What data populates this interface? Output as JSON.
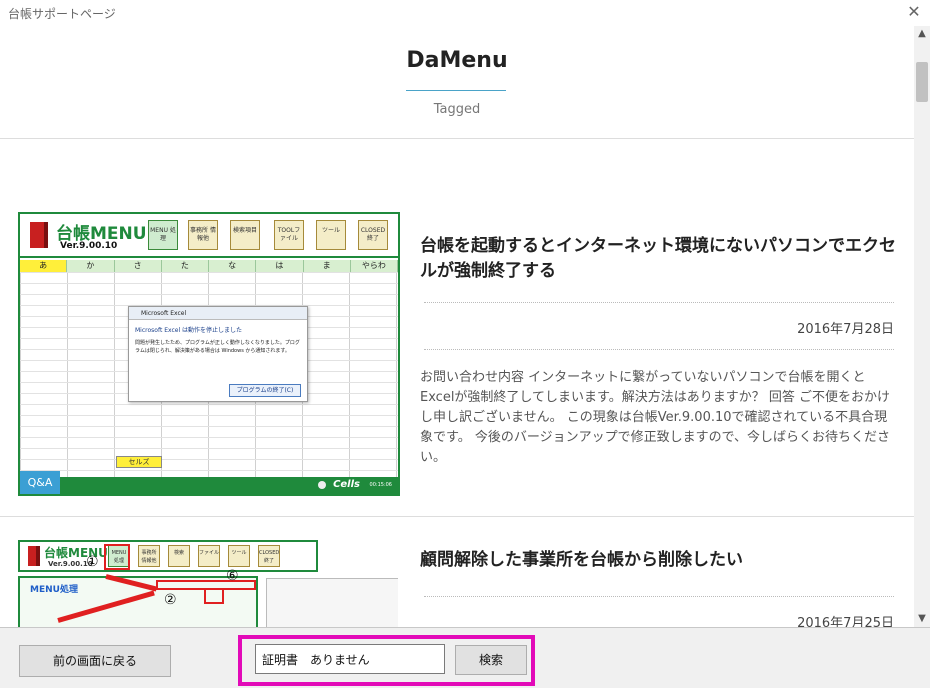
{
  "window": {
    "title": "台帳サポートページ",
    "close_glyph": "✕"
  },
  "header": {
    "title": "DaMenu",
    "subtitle": "Tagged"
  },
  "posts": [
    {
      "title": "台帳を起動するとインターネット環境にないパソコンでエクセルが強制終了する",
      "date": "2016年7月28日",
      "excerpt": "お問い合わせ内容 インターネットに繋がっていないパソコンで台帳を開くとExcelが強制終了してしまいます。解決方法はありますか？ 回答 ご不便をおかけし申し訳ございません。 この現象は台帳Ver.9.00.10で確認されている不具合現象です。 今後のバージョンアップで修正致しますので、今しばらくお待ちください。",
      "category": "Q&A",
      "thumbnail": {
        "brand": "台帳MENU",
        "version": "Ver.9.00.10",
        "toolbar": [
          "MENU 処 理",
          "事務所 情報他",
          "検索項目",
          "TOOLファイル",
          "ツール",
          "CLOSED 終了"
        ],
        "columns": [
          "あ",
          "か",
          "さ",
          "た",
          "な",
          "は",
          "ま",
          "やらわ"
        ],
        "dialog_title": "Microsoft Excel",
        "dialog_message": "Microsoft Excel は動作を停止しました",
        "dialog_body": "問題が発生したため、プログラムが正しく動作しなくなりました。プログラムは閉じられ、解決策がある場合は Windows から通知されます。",
        "dialog_button": "プログラムの終了(C)",
        "cell_label": "セルズ",
        "footer_brand": "Cells",
        "footer_time": "00:15:06"
      }
    },
    {
      "title": "顧問解除した事業所を台帳から削除したい",
      "date": "2016年7月25日",
      "thumbnail": {
        "brand": "台帳MENU",
        "version": "Ver.9.00.10",
        "toolbar": [
          "MENU 処理",
          "事務所 情報他",
          "検索",
          "ファイル",
          "ツール",
          "CLOSED 終了"
        ],
        "panel_label": "MENU処理",
        "step_labels": [
          "①",
          "②",
          "⑥"
        ]
      }
    }
  ],
  "scrollbar": {
    "up_glyph": "▲",
    "down_glyph": "▼"
  },
  "bottom": {
    "back_label": "前の画面に戻る",
    "search_value": "証明書　ありません",
    "search_label": "検索",
    "highlight_color": "#e20ab8"
  }
}
